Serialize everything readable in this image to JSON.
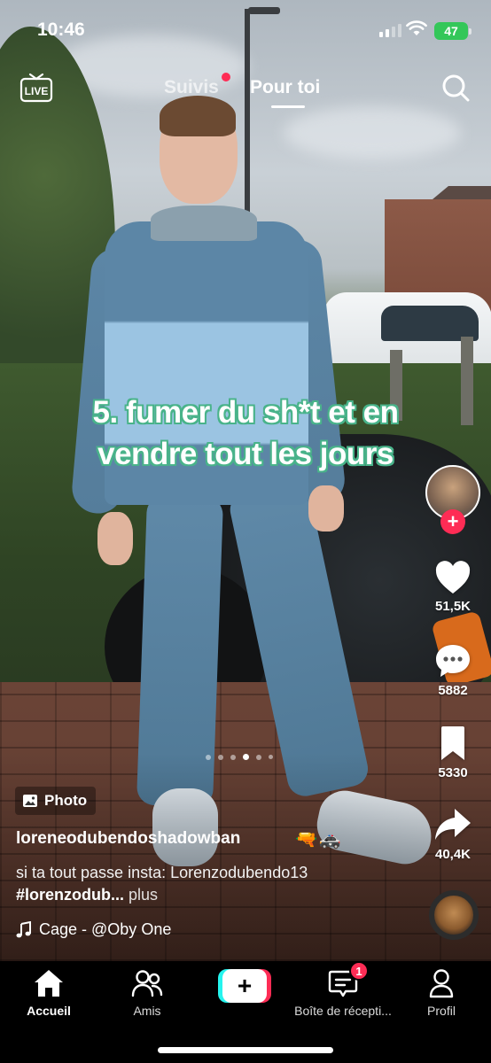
{
  "status_bar": {
    "time": "10:46",
    "battery": "47"
  },
  "top_nav": {
    "live_label": "LIVE",
    "tabs": [
      {
        "label": "Suivis",
        "active": false,
        "has_dot": true
      },
      {
        "label": "Pour toi",
        "active": true
      }
    ],
    "search_icon": "search-icon"
  },
  "caption": {
    "line1": "5. fumer du sh*t et en",
    "line2": "vendre tout les jours",
    "stroke_color": "#49b38a"
  },
  "right_rail": {
    "like_count": "51,5K",
    "comment_count": "5882",
    "bookmark_count": "5330",
    "share_count": "40,4K"
  },
  "carousel": {
    "count": 6,
    "active_index": 3
  },
  "post": {
    "type_badge": "Photo",
    "username": "loreneodubendoshadowban",
    "username_emojis": [
      "🔫",
      "🚓"
    ],
    "description_text": "si ta tout passe insta: Lorenzodubendo13 ",
    "hashtag": "#lorenzodub...",
    "more_label": "plus",
    "sound": "Cage - @Oby One"
  },
  "tab_bar": {
    "home": "Accueil",
    "friends": "Amis",
    "inbox": "Boîte de récepti...",
    "inbox_badge": "1",
    "profile": "Profil"
  },
  "colors": {
    "accent": "#fe2c55",
    "cyan": "#25f4ee",
    "battery": "#34c759"
  }
}
